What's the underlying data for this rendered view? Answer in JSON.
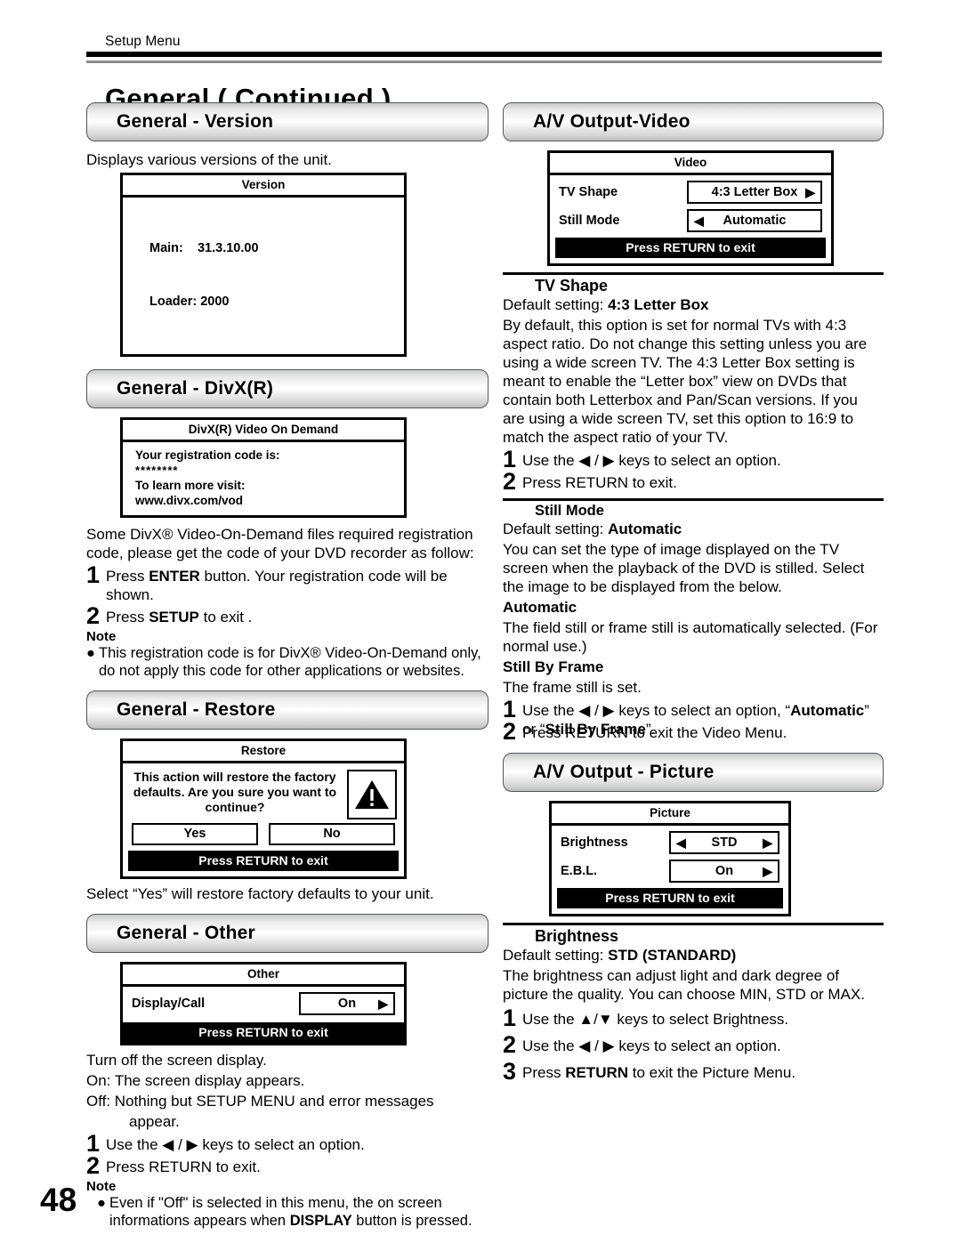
{
  "header": {
    "running_head": "Setup Menu",
    "page_title": "General  ( Continued )"
  },
  "folio": "48",
  "left_column": {
    "version_section": {
      "banner": "General - Version",
      "intro": "Displays various versions of the unit.",
      "osd": {
        "title": "Version",
        "line1": "Main:    31.3.10.00",
        "line2": "Loader: 2000"
      }
    },
    "divx_section": {
      "banner": "General - DivX(R)",
      "osd": {
        "title": "DivX(R) Video On Demand",
        "line1": "Your registration code is:",
        "code": "********",
        "line2": "To learn more visit:",
        "url": "www.divx.com/vod"
      },
      "paragraph": "Some DivX® Video-On-Demand files required registration code, please get the code of your DVD recorder as follow:",
      "steps": [
        {
          "num": "1",
          "text_pre": "Press ",
          "bold": "ENTER",
          "text_post": " button. Your registration code will be shown."
        },
        {
          "num": "2",
          "text_pre": "Press ",
          "bold": "SETUP",
          "text_post": " to exit ."
        }
      ],
      "note_heading": "Note",
      "note_text": "This registration code is for DivX® Video-On-Demand only, do not apply this code for other applications or websites."
    },
    "restore_section": {
      "banner": "General - Restore",
      "osd": {
        "title": "Restore",
        "message": "This action will restore the factory defaults. Are you sure you want to continue?",
        "yes_label": "Yes",
        "no_label": "No",
        "footer": "Press RETURN to exit"
      },
      "caption": "Select “Yes” will restore factory defaults to your unit."
    },
    "other_section": {
      "banner": "General - Other",
      "osd": {
        "title": "Other",
        "row_label": "Display/Call",
        "row_value": "On",
        "footer": "Press RETURN to exit"
      },
      "line1": "Turn off the screen display.",
      "line2": "On:  The screen display appears.",
      "line3": "Off: Nothing but SETUP MENU and error messages",
      "line4": "appear.",
      "steps": [
        {
          "num": "1",
          "text": "Use the ◀ / ▶ keys to select an option."
        },
        {
          "num": "2",
          "text": "Press RETURN to exit."
        }
      ],
      "note_heading": "Note",
      "note_pre": "Even if \"Off\" is selected in this menu, the on screen informations appears when ",
      "note_bold": "DISPLAY",
      "note_post": " button is pressed."
    }
  },
  "right_column": {
    "av_video_section": {
      "banner": "A/V Output-Video",
      "osd": {
        "title": "Video",
        "row1_label": "TV Shape",
        "row1_value": "4:3 Letter Box",
        "row2_label": "Still Mode",
        "row2_value": "Automatic",
        "footer": "Press RETURN to exit"
      }
    },
    "tv_shape": {
      "heading": "TV Shape",
      "default_label": "Default setting: ",
      "default_value": "4:3 Letter Box",
      "paragraph": "By default, this option is set for normal TVs with 4:3 aspect ratio. Do not change this setting unless you are using a wide screen TV. The 4:3 Letter Box setting is meant to enable the “Letter box” view on DVDs that contain both Letterbox and Pan/Scan versions. If you are using a wide screen TV, set this option to 16:9 to match the aspect ratio of your TV.",
      "steps": [
        {
          "num": "1",
          "text": "Use the ◀ / ▶ keys to select an option."
        },
        {
          "num": "2",
          "text": "Press RETURN to exit."
        }
      ]
    },
    "still_mode": {
      "heading": "Still Mode",
      "default_label": "Default setting: ",
      "default_value": "Automatic",
      "paragraph": "You can set the type of image displayed on the TV screen when the playback of the DVD is stilled. Select the image to be displayed from the below.",
      "opt1_heading": "Automatic",
      "opt1_text": "The field still or frame still is automatically selected. (For normal use.)",
      "opt2_heading": "Still By Frame",
      "opt2_text": "The frame still is set.",
      "step1_num": "1",
      "step1_pre": "Use the ◀ / ▶ keys to select an option, “",
      "step1_bold": "Automatic",
      "step1_mid": "” or “",
      "step1_bold2": "Still By Frame",
      "step1_post": "”.",
      "step2_num": "2",
      "step2_text": "Press RETURN to exit the Video Menu."
    },
    "av_picture_section": {
      "banner": "A/V Output - Picture",
      "osd": {
        "title": "Picture",
        "row1_label": "Brightness",
        "row1_value": "STD",
        "row2_label": "E.B.L.",
        "row2_value": "On",
        "footer": "Press RETURN to exit"
      }
    },
    "brightness": {
      "heading": "Brightness",
      "default_label": "Default setting: ",
      "default_value": "STD (STANDARD)",
      "paragraph": "The brightness can adjust light and dark degree of picture the quality. You can choose MIN, STD or MAX.",
      "steps": [
        {
          "num": "1",
          "text": "Use the ▲/▼ keys to select Brightness."
        },
        {
          "num": "2",
          "text": "Use the ◀ / ▶ keys to select an option."
        }
      ],
      "step3_num": "3",
      "step3_pre": "Press ",
      "step3_bold": "RETURN",
      "step3_post": " to exit the Picture Menu."
    }
  }
}
